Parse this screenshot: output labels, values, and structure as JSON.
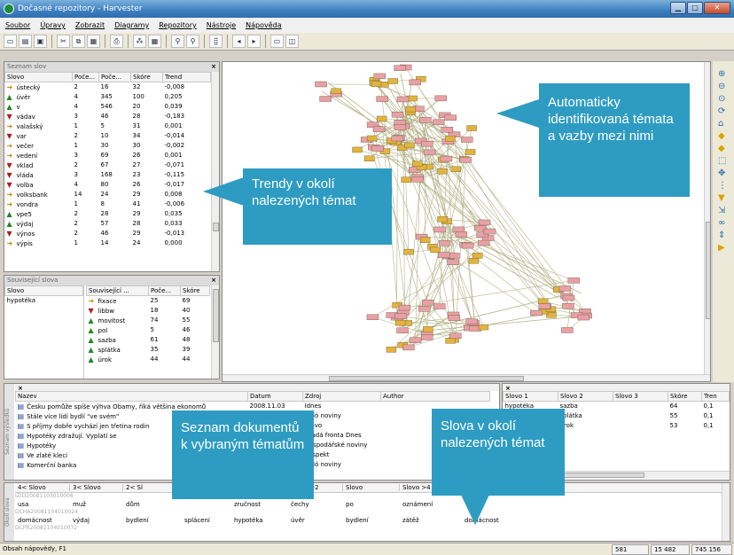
{
  "window": {
    "title": "Dočasné repozitory - Harvester"
  },
  "menu": [
    "Soubor",
    "Úpravy",
    "Zobrazit",
    "Diagramy",
    "Repozitory",
    "Nástroje",
    "Nápověda"
  ],
  "toolbar_icons": [
    "new-icon",
    "open-icon",
    "save-icon",
    "cut-icon",
    "copy-icon",
    "paste-icon",
    "print-icon",
    "graph-icon",
    "table-icon",
    "find-icon",
    "find-next-icon",
    "layout-icon",
    "back-icon",
    "forward-icon",
    "window-icon",
    "split-icon"
  ],
  "word_list": {
    "title": "Seznam slov",
    "columns": [
      "Slovo",
      "Poče...",
      "Poče...",
      "Skóre",
      "Trend"
    ],
    "rows": [
      {
        "trend": "rt",
        "word": "ústecký",
        "c1": "2",
        "c2": "16",
        "score": "32",
        "t": "-0,008"
      },
      {
        "trend": "up",
        "word": "úvěr",
        "c1": "4",
        "c2": "345",
        "score": "100",
        "t": "0,205"
      },
      {
        "trend": "up",
        "word": "v",
        "c1": "4",
        "c2": "546",
        "score": "20",
        "t": "0,039"
      },
      {
        "trend": "dn",
        "word": "vádav",
        "c1": "3",
        "c2": "46",
        "score": "28",
        "t": "-0,183"
      },
      {
        "trend": "rt",
        "word": "valašský",
        "c1": "1",
        "c2": "5",
        "score": "31",
        "t": "0,001"
      },
      {
        "trend": "dn",
        "word": "var",
        "c1": "2",
        "c2": "10",
        "score": "34",
        "t": "-0,014"
      },
      {
        "trend": "rt",
        "word": "večer",
        "c1": "1",
        "c2": "30",
        "score": "30",
        "t": "-0,002"
      },
      {
        "trend": "rt",
        "word": "vedení",
        "c1": "3",
        "c2": "69",
        "score": "26",
        "t": "0,001"
      },
      {
        "trend": "dn",
        "word": "vklad",
        "c1": "2",
        "c2": "67",
        "score": "27",
        "t": "-0,071"
      },
      {
        "trend": "dn",
        "word": "vláda",
        "c1": "3",
        "c2": "168",
        "score": "23",
        "t": "-0,115"
      },
      {
        "trend": "dn",
        "word": "volba",
        "c1": "4",
        "c2": "80",
        "score": "26",
        "t": "-0,017"
      },
      {
        "trend": "rt",
        "word": "volksbank",
        "c1": "14",
        "c2": "24",
        "score": "29",
        "t": "0,008"
      },
      {
        "trend": "rt",
        "word": "vondra",
        "c1": "1",
        "c2": "8",
        "score": "41",
        "t": "-0,006"
      },
      {
        "trend": "up",
        "word": "vpe5",
        "c1": "2",
        "c2": "28",
        "score": "29",
        "t": "0,035"
      },
      {
        "trend": "up",
        "word": "výdaj",
        "c1": "2",
        "c2": "57",
        "score": "28",
        "t": "0,033"
      },
      {
        "trend": "dn",
        "word": "výnos",
        "c1": "2",
        "c2": "46",
        "score": "29",
        "t": "-0,013"
      },
      {
        "trend": "rt",
        "word": "výpis",
        "c1": "1",
        "c2": "14",
        "score": "24",
        "t": "0,000"
      }
    ]
  },
  "related": {
    "title": "Související slova",
    "left_col": "Slovo",
    "left_value": "hypotéka",
    "columns": [
      "Související ...",
      "Poče...",
      "Skóre"
    ],
    "rows": [
      {
        "trend": "rt",
        "word": "fixace",
        "c": "25",
        "s": "69"
      },
      {
        "trend": "dn",
        "word": "libbw",
        "c": "18",
        "s": "40"
      },
      {
        "trend": "up",
        "word": "movitost",
        "c": "74",
        "s": "55"
      },
      {
        "trend": "up",
        "word": "pol",
        "c": "5",
        "s": "46"
      },
      {
        "trend": "up",
        "word": "sazba",
        "c": "61",
        "s": "48"
      },
      {
        "trend": "up",
        "word": "splátka",
        "c": "35",
        "s": "39"
      },
      {
        "trend": "up",
        "word": "úrok",
        "c": "44",
        "s": "44"
      }
    ]
  },
  "documents": {
    "side_label": "Seznam výsledků",
    "columns": [
      "Nazev",
      "Datum",
      "Zdroj",
      "Author"
    ],
    "rows": [
      {
        "name": "Česku pomůže spíše výhva Obamy, říká většina ekonomů",
        "date": "2008.11.03",
        "src": "Idnes"
      },
      {
        "name": "Stále více lidí bydlí \"ve svém\"",
        "date": "",
        "src": "Haló noviny"
      },
      {
        "name": "S příjmy dobře vychází jen třetina rodin",
        "date": "",
        "src": "Právo"
      },
      {
        "name": "Hypotéky zdražují. Vyplatí se",
        "date": "",
        "src": "Mladá fronta Dnes"
      },
      {
        "name": "Hypotéky",
        "date": "",
        "src": "Hospodářské noviny"
      },
      {
        "name": "Ve zlaté kleci",
        "date": "",
        "src": "Respekt"
      },
      {
        "name": "Komerční banka",
        "date": "",
        "src": "Haló noviny"
      }
    ]
  },
  "triples": {
    "columns": [
      "Slovo 1",
      "Slovo 2",
      "Slovo 3",
      "Skóre",
      "Tren"
    ],
    "rows": [
      {
        "w1": "hypotéka",
        "w2": "sazba",
        "w3": "",
        "score": "64",
        "t": "0,1"
      },
      {
        "w1": "hypotéka",
        "w2": "splátka",
        "w3": "",
        "score": "55",
        "t": "0,1"
      },
      {
        "w1": "sazba",
        "w2": "úrok",
        "w3": "",
        "score": "53",
        "t": "0,1"
      }
    ]
  },
  "context": {
    "side_label": "Okolí slova",
    "columns": [
      "4< Slovo",
      "3< Slovo",
      "2< Sl",
      "",
      "Slovo >1",
      "Slovo >2",
      "Slovo",
      "Slovo >4"
    ],
    "ids": [
      "IZID20081103010006",
      "DCHA20081104010024",
      "DCPR20081104010072"
    ],
    "row1": [
      "usa",
      "muž",
      "dům",
      "",
      "zručnost",
      "čechy",
      "po",
      "oznámení"
    ],
    "row2": [
      "domácnost",
      "výdaj",
      "bydlení",
      "splácení",
      "hypotéka",
      "úvěr",
      "bydlení",
      "zátěž",
      "domácnost"
    ]
  },
  "callouts": {
    "trends": "Trendy v okolí nalezených témat",
    "topics": "Automaticky identifikovaná témata a vazby mezi nimi",
    "docs": "Seznam dokumentů k vybraným tématům",
    "words": "Slova v okolí nalezených témat"
  },
  "status": {
    "help": "Obsah nápovědy, F1",
    "v1": "581",
    "v2": "15 482",
    "v3": "745 156"
  },
  "colors": {
    "callout": "#2e9cc2",
    "node_pink": "#e8a0a6",
    "node_yellow": "#e2b43c",
    "edge": "#b5b48a"
  }
}
